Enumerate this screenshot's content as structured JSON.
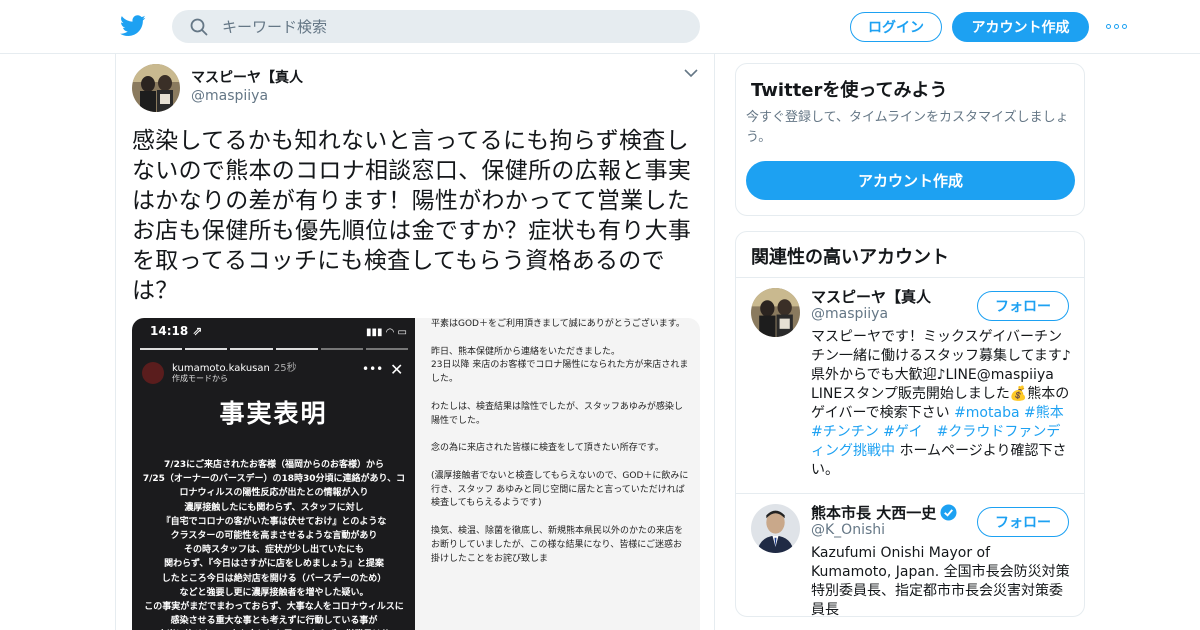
{
  "header": {
    "search_placeholder": "キーワード検索",
    "login_label": "ログイン",
    "signup_label": "アカウント作成",
    "brand_color": "#1da1f2"
  },
  "tweet": {
    "author_name": "マスピーヤ【真人",
    "author_handle": "@maspiiya",
    "text": "感染してるかも知れないと言ってるにも拘らず検査しないので熊本のコロナ相談窓口、保健所の広報と事実はかなりの差が有ります！陽性がわかってて営業したお店も保健所も優先順位は金ですか？症状も有り大事を取ってるコッチにも検査してもらう資格あるのでは？",
    "media_left": {
      "status_time": "14:18 ⇗",
      "status_icons": "▮▮▮ ◠ ▭",
      "story_user": "kumamoto.kakusan",
      "story_time": "25秒",
      "story_sub": "作成モードから",
      "title": "事実表明",
      "body": "7/23にご来店されたお客様（福岡からのお客様）から\n7/25（オーナーのバースデー）の18時30分頃に連絡があり、コロナウィルスの陽性反応が出たとの情報が入り\n濃厚接触したにも関わらず、スタッフに対し\n『自宅でコロナの客がいた事は伏せておけ』とのような\nクラスターの可能性を高まさせるような言動があり\nその時スタッフは、症状が少し出ていたにも\n関わらず、『今日はさすがに店をしめましょう』と提案\nしたところ今日は絶対店を開ける（バースデーのため）\nなどと強要し更に濃厚接触者を増やした疑い。\nこの事実がまだでまわっておらず、大事な人をコロナウィルスに感染させる重大な事とも考えずに行動している事が\n本当に許せない。人を金としか思っておらず、従業員は使"
    },
    "media_right": {
      "body": "平素はGOD＋をご利用頂きまして誠にありがとうございます。\n\n昨日、熊本保健所から連絡をいただきました。\n23日以降 来店のお客様でコロナ陽性になられた方が来店されました。\n\nわたしは、検査結果は陰性でしたが、スタッフあゆみが感染し陽性でした。\n\n念の為に来店された皆様に検査をして頂きたい所存です。\n\n(濃厚接触者でないと検査してもらえないので、GOD＋に飲みに行き、スタッフ あゆみと同じ空間に居たと言っていただければ検査してもらえるようです)\n\n換気、検温、除菌を徹底し、新規熊本県民以外のかたの来店をお断りしていましたが、この様な結果になり、皆様にご迷惑お掛けしたことをお詫び致しま"
    }
  },
  "promo": {
    "title": "Twitterを使ってみよう",
    "description": "今すぐ登録して、タイムラインをカスタマイズしましょう。",
    "button_label": "アカウント作成"
  },
  "related": {
    "title": "関連性の高いアカウント",
    "accounts": [
      {
        "name": "マスピーヤ【真人",
        "handle": "@maspiiya",
        "follow_label": "フォロー",
        "bio_text": "マスピーヤです！ミックスゲイバーチンチン一緒に働けるスタッフ募集してます♪県外からでも大歓迎♪LINE@maspiiya LINEスタンプ販売開始しました💰熊本のゲイバーで検索下さい ",
        "bio_tags": "#motaba #熊本 #チンチン #ゲイ　#クラウドファンディング挑戦中",
        "bio_tail": " ホームページより確認下さい。"
      },
      {
        "name": "熊本市長 大西一史",
        "handle": "@K_Onishi",
        "follow_label": "フォロー",
        "bio_text": "Kazufumi Onishi Mayor of Kumamoto, Japan. 全国市長会防災対策特別委員長、指定都市市長会災害対策委員長"
      }
    ]
  }
}
